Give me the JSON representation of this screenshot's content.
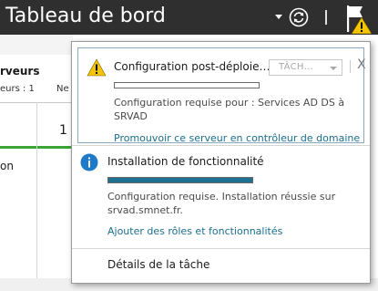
{
  "header": {
    "title": "Tableau de bord",
    "background": "#2f2f2f",
    "icons": [
      "dropdown-caret-icon",
      "refresh-icon",
      "notifications-flag-icon",
      "warning-icon"
    ]
  },
  "background_dashboard": {
    "card_title": "rveurs",
    "card_sub1": "eurs : 1",
    "card_sub2": "Ne",
    "count": "1",
    "row_text": "on",
    "accent_green": "#3aa534"
  },
  "notifications": [
    {
      "type": "warning",
      "icon": "warning-icon",
      "title": "Configuration post-déploie…",
      "task_button": "TÂCH…",
      "close_label": "X",
      "progress": 0,
      "description": "Configuration requise pour : Services AD DS à SRVAD",
      "link": "Promouvoir ce serveur en contrôleur de domaine"
    },
    {
      "type": "info",
      "icon": "info-icon",
      "title": "Installation de fonctionnalité",
      "progress": 1,
      "description": "Configuration requise. Installation réussie sur srvad.smnet.fr.",
      "link": "Ajouter des rôles et fonctionnalités"
    }
  ],
  "task_details": "Détails de la tâche",
  "colors": {
    "link": "#1a6e8e",
    "progress_fill": "#1e7191",
    "warning": "#f5c400",
    "info": "#1e79c8"
  }
}
